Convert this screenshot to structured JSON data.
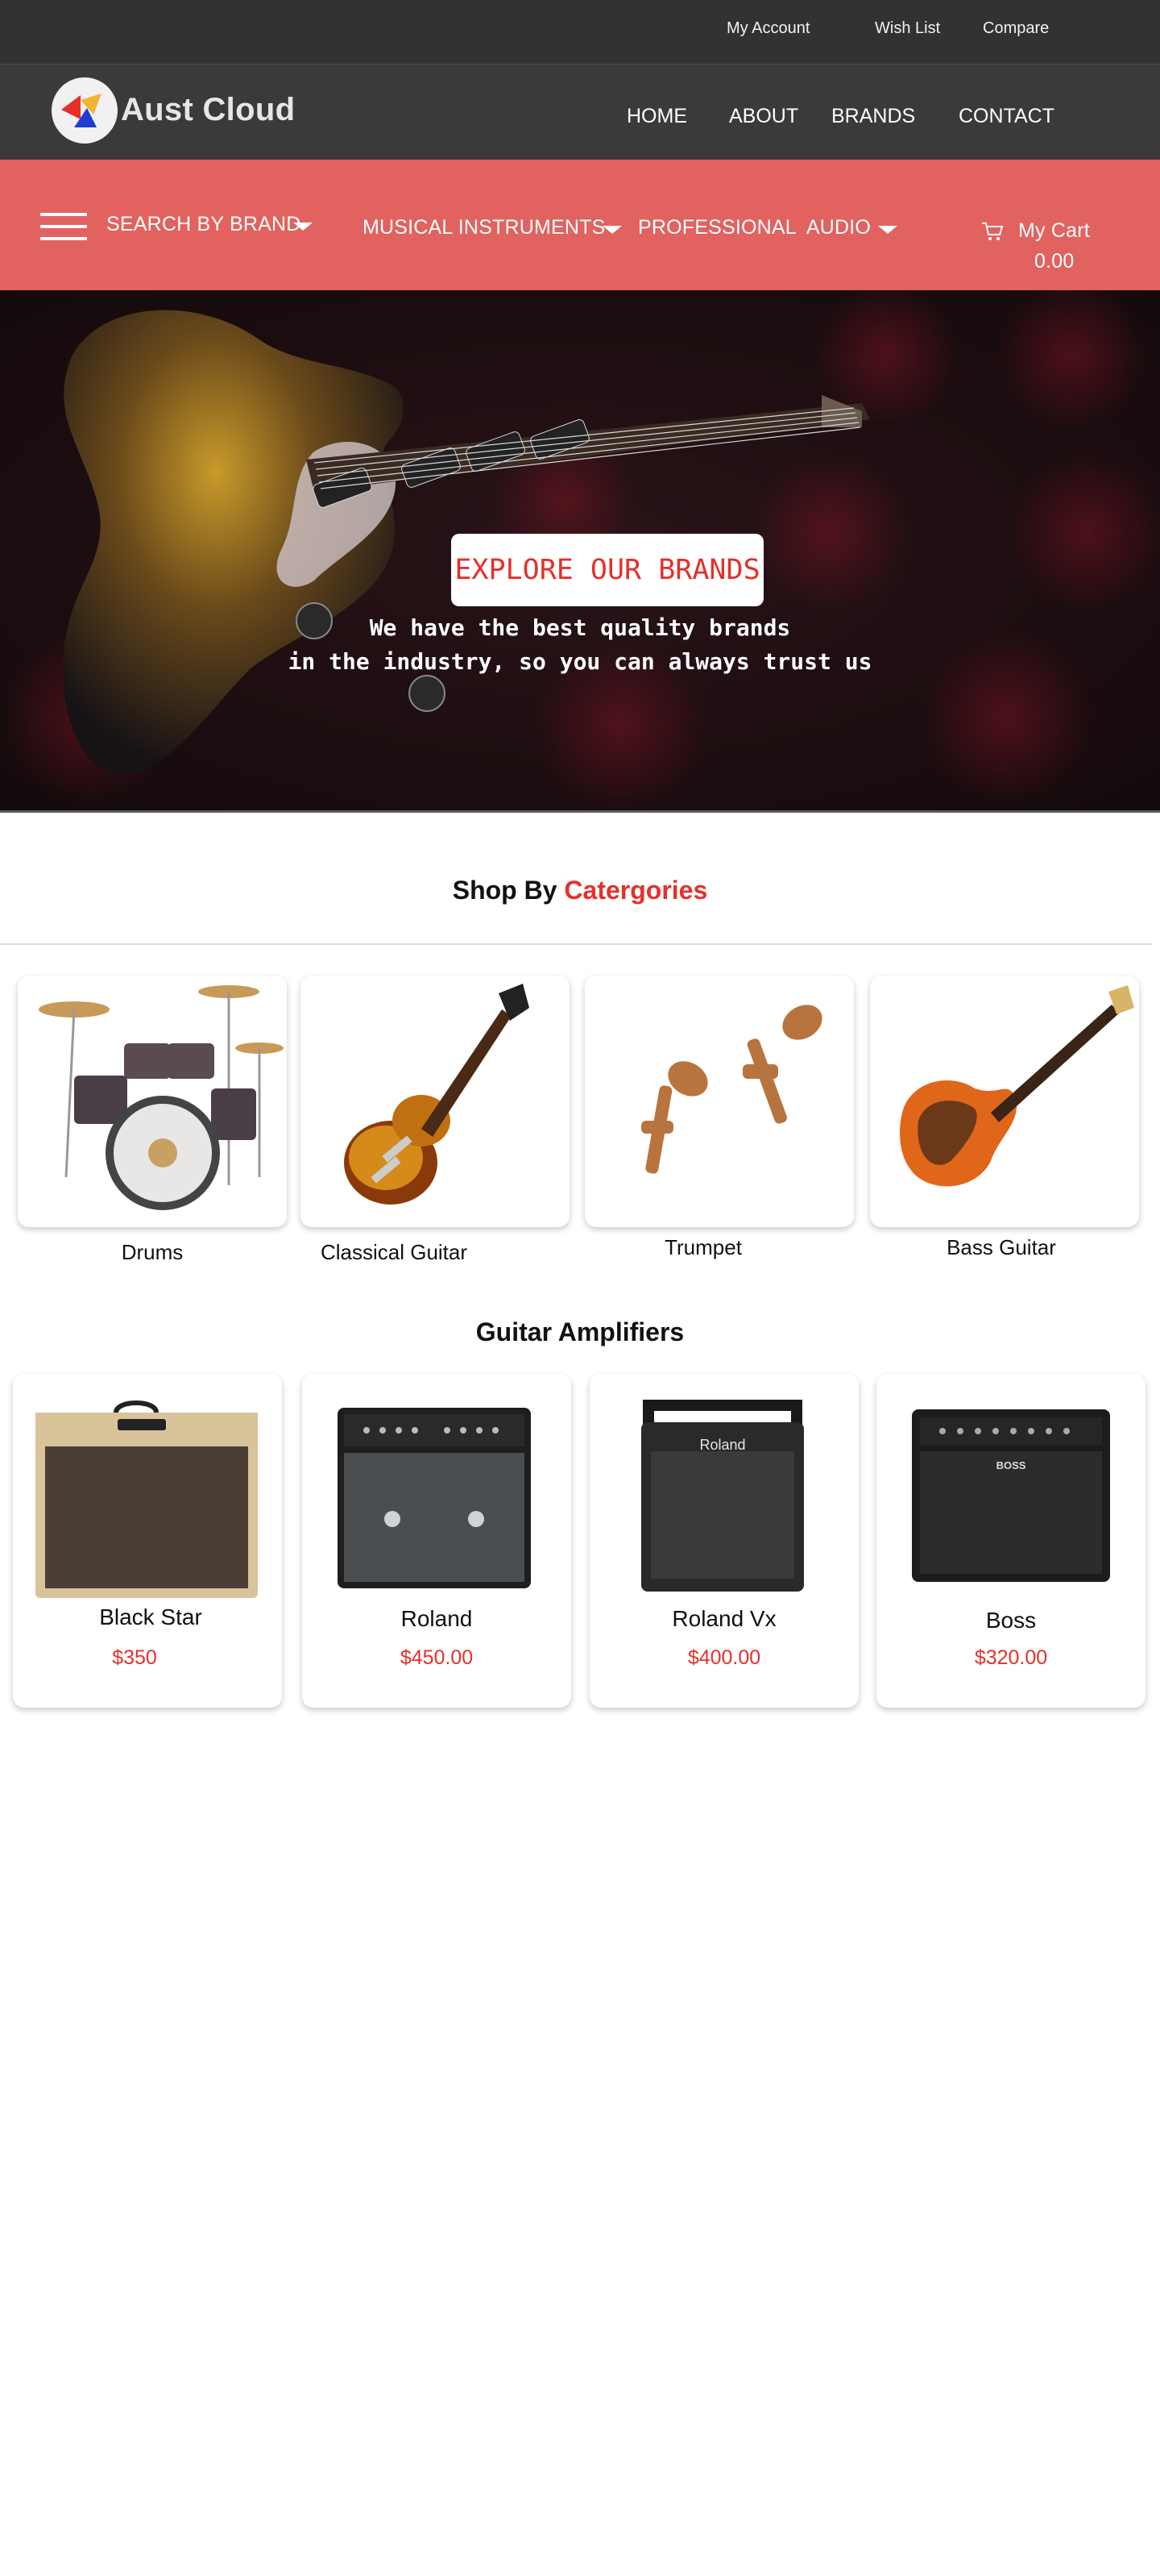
{
  "topbar": {
    "my_account": "My Account",
    "wish_list": "Wish List",
    "compare": "Compare"
  },
  "header": {
    "brand_name": "Aust Cloud",
    "logo_icon": "triangles-logo-icon",
    "nav": {
      "home": "HOME",
      "about": "ABOUT",
      "brands": "BRANDS",
      "contact": "CONTACT"
    }
  },
  "category_bar": {
    "search_by_brand": "SEARCH BY BRAND",
    "musical_instruments": "MUSICAL INSTRUMENTS",
    "professional_audio": "PROFESSIONAL  AUDIO",
    "cart_label": "My Cart",
    "cart_value": "0.00",
    "background_color": "#e2625f"
  },
  "hero": {
    "button_label": "EXPLORE OUR BRANDS",
    "line1": "We have the best quality brands",
    "line2": "in the industry, so you can always trust us"
  },
  "categories": {
    "title_prefix": "Shop By",
    "title_accent": "Catergories",
    "items": [
      {
        "label": "Drums",
        "icon": "drum-kit-image"
      },
      {
        "label": "Classical Guitar",
        "icon": "electric-guitar-image"
      },
      {
        "label": "Trumpet",
        "icon": "trumpet-image"
      },
      {
        "label": "Bass Guitar",
        "icon": "bass-guitar-image"
      }
    ]
  },
  "amplifiers": {
    "title": "Guitar Amplifiers",
    "items": [
      {
        "name": "Black Star",
        "price": "$350",
        "icon": "amplifier-image"
      },
      {
        "name": "Roland",
        "price": "$450.00",
        "icon": "amplifier-image"
      },
      {
        "name": "Roland Vx",
        "price": "$400.00",
        "icon": "amplifier-image",
        "badge": "Roland"
      },
      {
        "name": "Boss",
        "price": "$320.00",
        "icon": "amplifier-image",
        "badge": "BOSS"
      }
    ]
  },
  "colors": {
    "accent_red": "#e5302b",
    "topbar": "#323233",
    "header": "#3a3a3a"
  }
}
